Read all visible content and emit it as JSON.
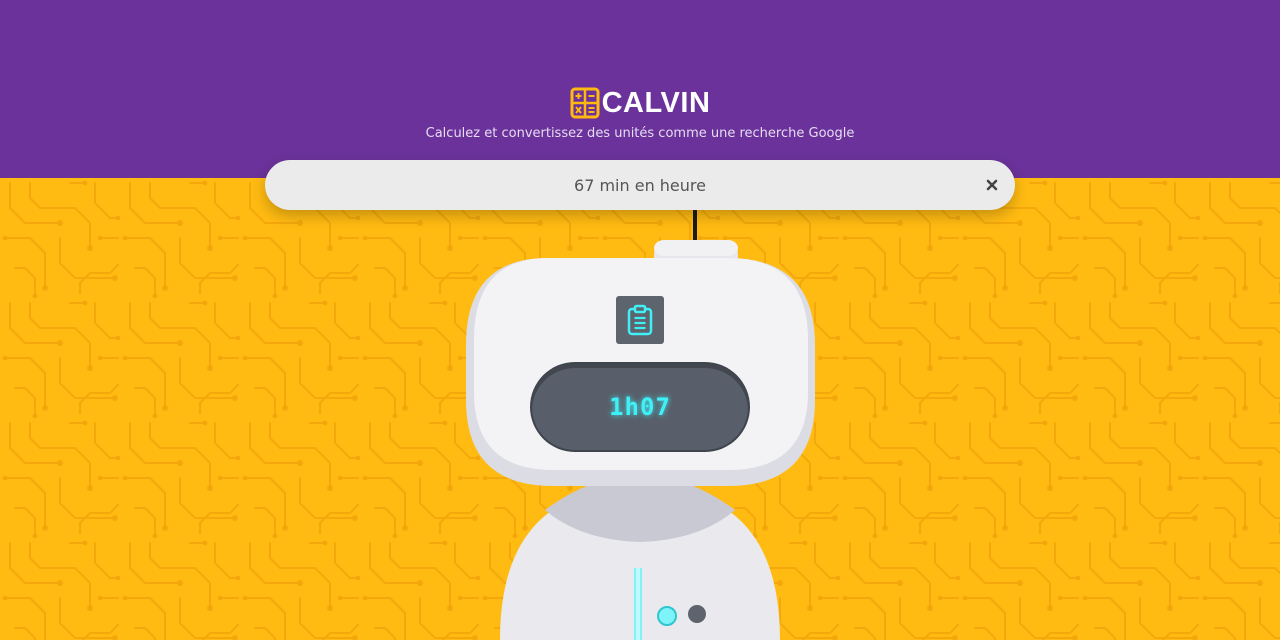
{
  "app": {
    "name": "CALVIN",
    "tagline": "Calculez et convertissez des unités comme une recherche Google"
  },
  "search": {
    "value": "67 min en heure"
  },
  "result": {
    "value": "1h07"
  },
  "icons": {
    "logo": "calculator-icon",
    "clear": "close-icon",
    "copy": "clipboard-icon"
  },
  "colors": {
    "header_bg": "#6a329a",
    "main_bg": "#ffbb12",
    "logo_accent": "#ffb90f",
    "display_text": "#3ff0f7",
    "search_bg": "#ebebeb"
  }
}
